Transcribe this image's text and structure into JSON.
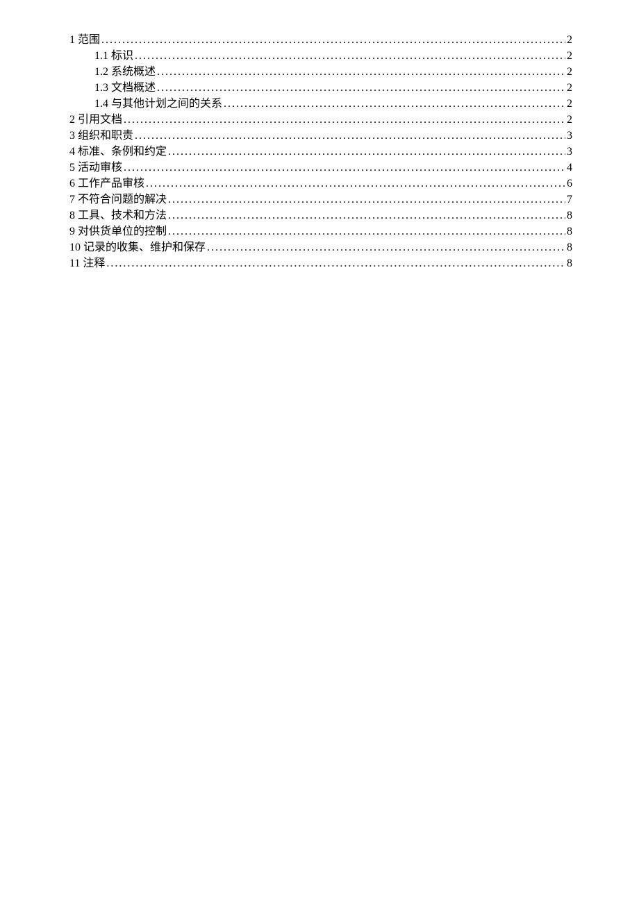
{
  "toc": [
    {
      "level": 1,
      "number": "1",
      "title": "范围",
      "page": "2"
    },
    {
      "level": 2,
      "number": "1.1",
      "title": "标识",
      "page": "2"
    },
    {
      "level": 2,
      "number": "1.2",
      "title": "系统概述",
      "page": "2"
    },
    {
      "level": 2,
      "number": "1.3",
      "title": "文档概述",
      "page": "2"
    },
    {
      "level": 2,
      "number": "1.4",
      "title": "与其他计划之间的关系",
      "page": "2"
    },
    {
      "level": 1,
      "number": "2",
      "title": "引用文档",
      "page": "2"
    },
    {
      "level": 1,
      "number": "3",
      "title": "组织和职责",
      "page": "3"
    },
    {
      "level": 1,
      "number": "4",
      "title": "标准、条例和约定",
      "page": "3"
    },
    {
      "level": 1,
      "number": "5",
      "title": "活动审核",
      "page": "4"
    },
    {
      "level": 1,
      "number": "6",
      "title": "工作产品审核",
      "page": "6"
    },
    {
      "level": 1,
      "number": "7",
      "title": "不符合问题的解决",
      "page": "7"
    },
    {
      "level": 1,
      "number": "8",
      "title": "工具、技术和方法",
      "page": "8"
    },
    {
      "level": 1,
      "number": "9",
      "title": "对供货单位的控制",
      "page": "8"
    },
    {
      "level": 1,
      "number": "10",
      "title": "记录的收集、维护和保存",
      "page": "8"
    },
    {
      "level": 1,
      "number": "11",
      "title": "注释",
      "page": "8"
    }
  ]
}
